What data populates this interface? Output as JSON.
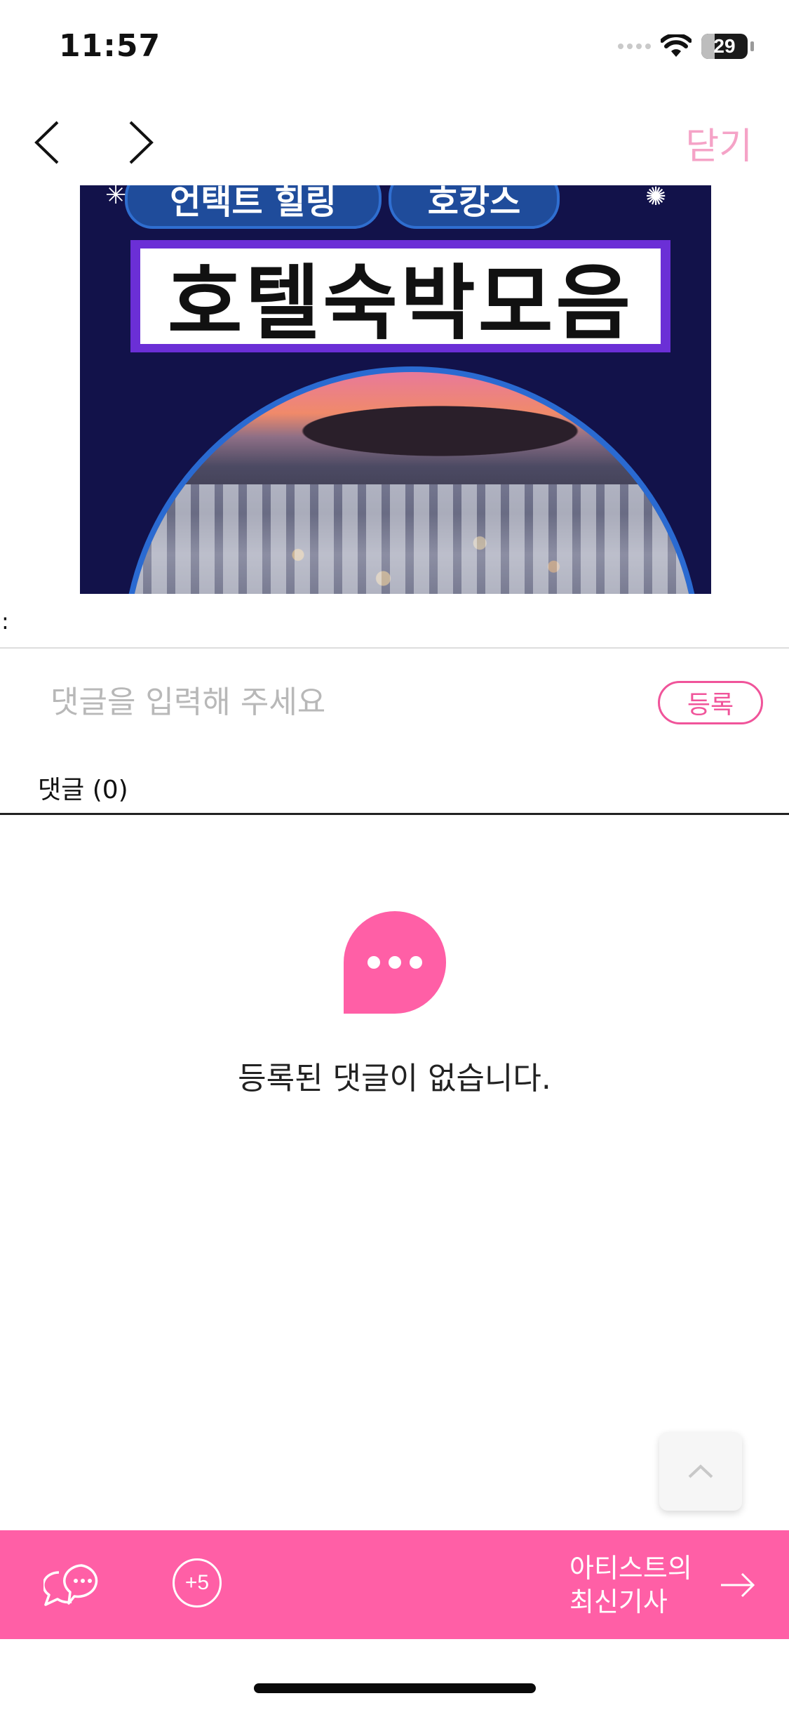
{
  "status_bar": {
    "time": "11:57",
    "battery": "29",
    "battery_fraction": 0.29
  },
  "nav": {
    "close_label": "닫기",
    "back_icon": "chevron-left-icon",
    "forward_icon": "chevron-right-icon"
  },
  "banner": {
    "tag1": "언택트 힐링",
    "tag2": "호캉스",
    "headline": "호텔숙박모음"
  },
  "colon": ":",
  "comment": {
    "placeholder": "댓글을 입력해 주세요",
    "value": "",
    "register_label": "등록",
    "count_label": "댓글",
    "count": "(0)",
    "empty_message": "등록된 댓글이 없습니다."
  },
  "bottom_bar": {
    "plus_badge": "+5",
    "latest_line1": "아티스트의",
    "latest_line2": "최신기사",
    "background": "#ff5fa6"
  },
  "colors": {
    "accent": "#f0549a",
    "close": "#f5a3c7"
  }
}
